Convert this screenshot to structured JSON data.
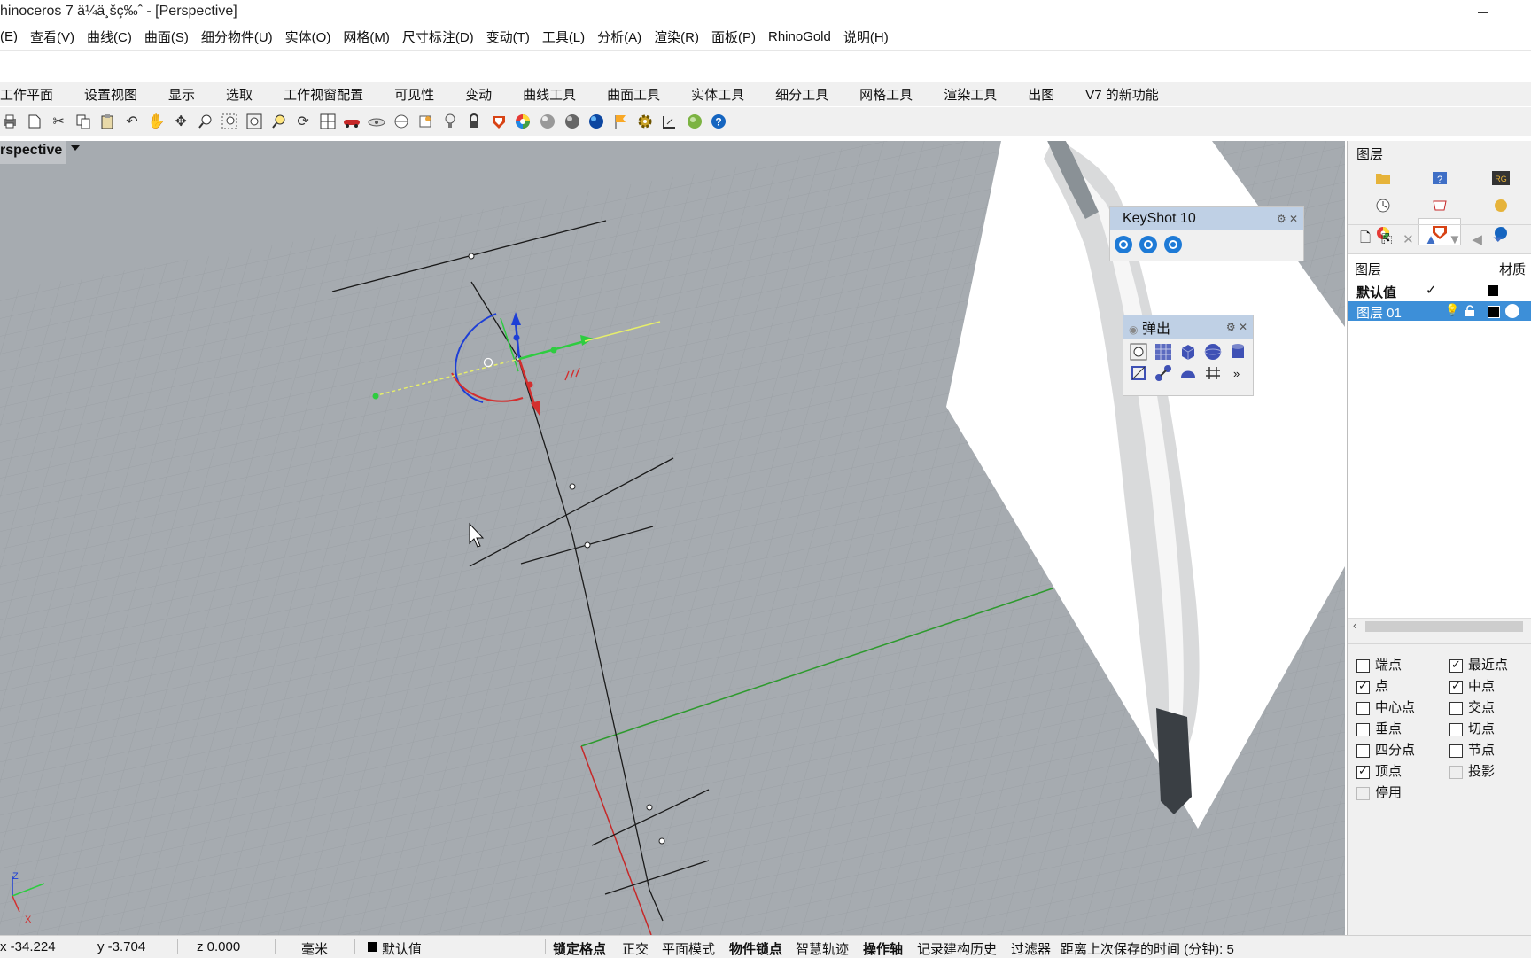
{
  "window": {
    "title": "hinoceros 7 ä¼ä¸šç‰ˆ - [Perspective]"
  },
  "menu": [
    "(E)",
    "查看(V)",
    "曲线(C)",
    "曲面(S)",
    "细分物件(U)",
    "实体(O)",
    "网格(M)",
    "尺寸标注(D)",
    "变动(T)",
    "工具(L)",
    "分析(A)",
    "渲染(R)",
    "面板(P)",
    "RhinoGold",
    "说明(H)"
  ],
  "tabs": [
    "工作平面",
    "设置视图",
    "显示",
    "选取",
    "工作视窗配置",
    "可见性",
    "变动",
    "曲线工具",
    "曲面工具",
    "实体工具",
    "细分工具",
    "网格工具",
    "渲染工具",
    "出图",
    "V7 的新功能"
  ],
  "toolbar_icons": [
    "print-icon",
    "new-file-icon",
    "cut-icon",
    "copy-icon",
    "paste-icon",
    "undo-icon",
    "pan-hand-icon",
    "move-view-icon",
    "zoom-icon",
    "zoom-window-icon",
    "zoom-extents-icon",
    "zoom-selected-icon",
    "rotate-view-icon",
    "four-views-icon",
    "car-icon",
    "camera-icon",
    "plane-icon",
    "snap-icon",
    "light-icon",
    "lock-icon",
    "shield-icon",
    "color-wheel-icon",
    "sphere-shaded-icon",
    "sphere-render-icon",
    "sphere-blue-icon",
    "flag-icon",
    "gear-icon",
    "dimension-icon",
    "render-globe-icon",
    "help-icon"
  ],
  "viewport": {
    "label": "rspective"
  },
  "keyshot": {
    "title": "KeyShot 10"
  },
  "popup": {
    "title": "弹出",
    "more": "»"
  },
  "layers": {
    "panel_title": "图层",
    "col_layer": "图层",
    "col_material": "材质",
    "rows": [
      {
        "name": "默认值",
        "check": "✓",
        "selected": false
      },
      {
        "name": "图层 01",
        "check": "",
        "selected": true
      }
    ]
  },
  "osnap": [
    {
      "label": "端点",
      "checked": false
    },
    {
      "label": "最近点",
      "checked": true
    },
    {
      "label": "点",
      "checked": true
    },
    {
      "label": "中点",
      "checked": true
    },
    {
      "label": "中心点",
      "checked": false
    },
    {
      "label": "交点",
      "checked": false
    },
    {
      "label": "垂点",
      "checked": false
    },
    {
      "label": "切点",
      "checked": false
    },
    {
      "label": "四分点",
      "checked": false
    },
    {
      "label": "节点",
      "checked": false
    },
    {
      "label": "顶点",
      "checked": true
    },
    {
      "label": "投影",
      "checked": false
    },
    {
      "label": "停用",
      "checked": false
    }
  ],
  "axes": {
    "z": "Z",
    "x": "X"
  },
  "status": {
    "x": "x -34.224",
    "y": "y -3.704",
    "z": "z 0.000",
    "unit": "毫米",
    "layer": "默认值",
    "grid_snap": "锁定格点",
    "ortho": "正交",
    "planar": "平面模式",
    "osnap": "物件锁点",
    "smarttrack": "智慧轨迹",
    "gumball": "操作轴",
    "history": "记录建构历史",
    "filter": "过滤器",
    "autosave": "距离上次保存的时间 (分钟): 5"
  }
}
